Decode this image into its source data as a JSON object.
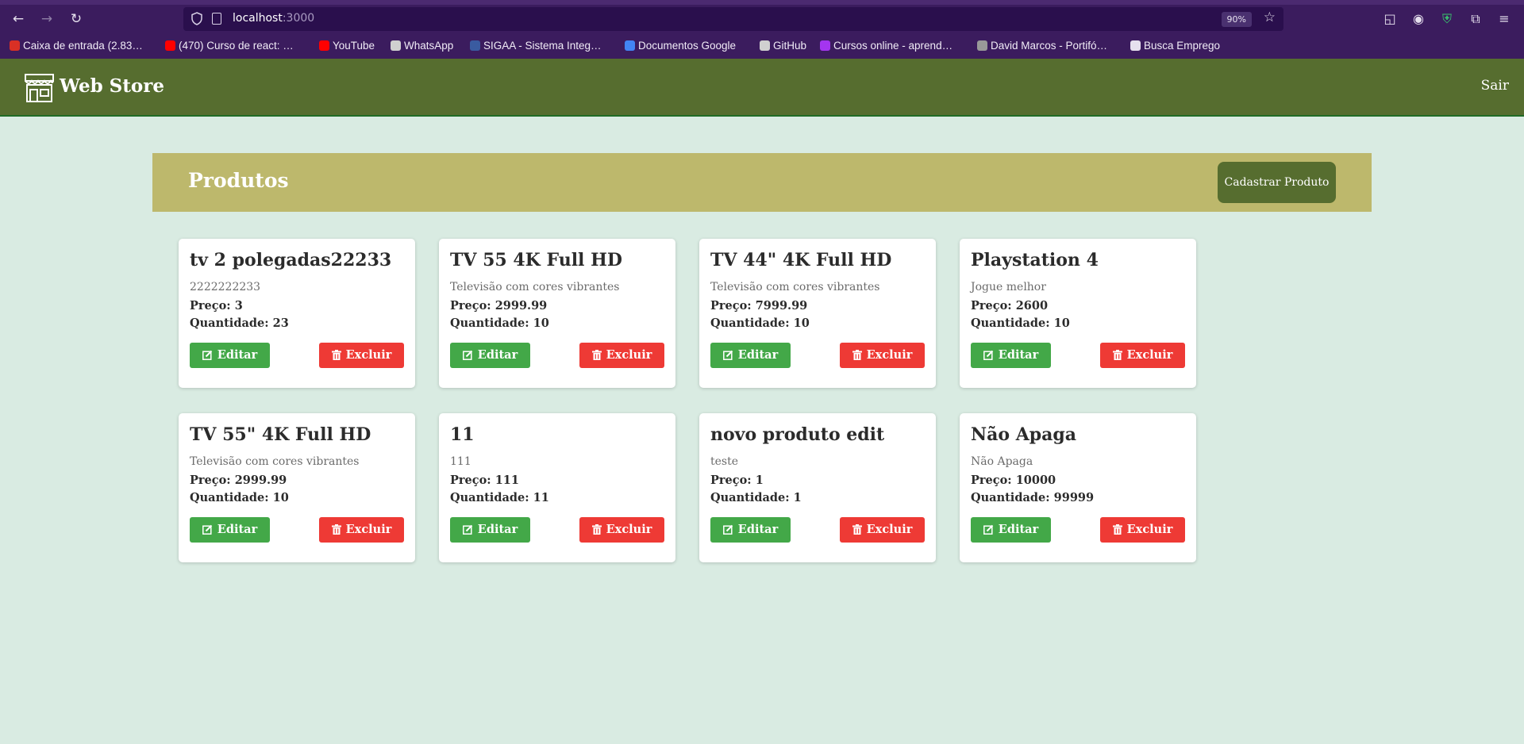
{
  "browser": {
    "url_host": "localhost",
    "url_port": ":3000",
    "zoom": "90%",
    "bookmarks": [
      {
        "label": "Caixa de entrada (2.83…",
        "icon": "gmail-icon",
        "color": "#d93025"
      },
      {
        "label": "(470) Curso de react: …",
        "icon": "youtube-icon",
        "color": "#ff0000"
      },
      {
        "label": "YouTube",
        "icon": "youtube-icon",
        "color": "#ff0000"
      },
      {
        "label": "WhatsApp",
        "icon": "whatsapp-icon",
        "color": "#d0d0d0"
      },
      {
        "label": "SIGAA - Sistema Integ…",
        "icon": "sigaa-icon",
        "color": "#3a5ba0"
      },
      {
        "label": "Documentos Google",
        "icon": "google-docs-icon",
        "color": "#4285f4"
      },
      {
        "label": "GitHub",
        "icon": "github-icon",
        "color": "#d0d0d0"
      },
      {
        "label": "Cursos online - aprend…",
        "icon": "udemy-icon",
        "color": "#a435f0"
      },
      {
        "label": "David Marcos - Portifó…",
        "icon": "portfolio-icon",
        "color": "#999999"
      },
      {
        "label": "Busca Emprego",
        "icon": "folder-icon",
        "color": "#e6e0ee"
      }
    ]
  },
  "header": {
    "brand": "Web Store",
    "logout_label": "Sair"
  },
  "products_bar": {
    "title": "Produtos",
    "add_label": "Cadastrar Produto"
  },
  "labels": {
    "price_prefix": "Preço:",
    "qty_prefix": "Quantidade:",
    "edit": "Editar",
    "delete": "Excluir"
  },
  "products": [
    {
      "name": "tv 2 polegadas22233",
      "description": "2222222233",
      "price": "3",
      "quantity": "23"
    },
    {
      "name": "TV 55 4K Full HD",
      "description": "Televisão com cores vibrantes",
      "price": "2999.99",
      "quantity": "10"
    },
    {
      "name": "TV 44\" 4K Full HD",
      "description": "Televisão com cores vibrantes",
      "price": "7999.99",
      "quantity": "10"
    },
    {
      "name": "Playstation 4",
      "description": "Jogue melhor",
      "price": "2600",
      "quantity": "10"
    },
    {
      "name": "TV 55\" 4K Full HD",
      "description": "Televisão com cores vibrantes",
      "price": "2999.99",
      "quantity": "10"
    },
    {
      "name": "11",
      "description": "111",
      "price": "111",
      "quantity": "11"
    },
    {
      "name": "novo produto edit",
      "description": "teste",
      "price": "1",
      "quantity": "1"
    },
    {
      "name": "Não Apaga",
      "description": "Não Apaga",
      "price": "10000",
      "quantity": "99999"
    }
  ],
  "colors": {
    "header": "#566d2f",
    "products_bar": "#bdb86c",
    "edit_button": "#43a848",
    "delete_button": "#ee3a35",
    "page_bg": "#d9ebe2"
  }
}
